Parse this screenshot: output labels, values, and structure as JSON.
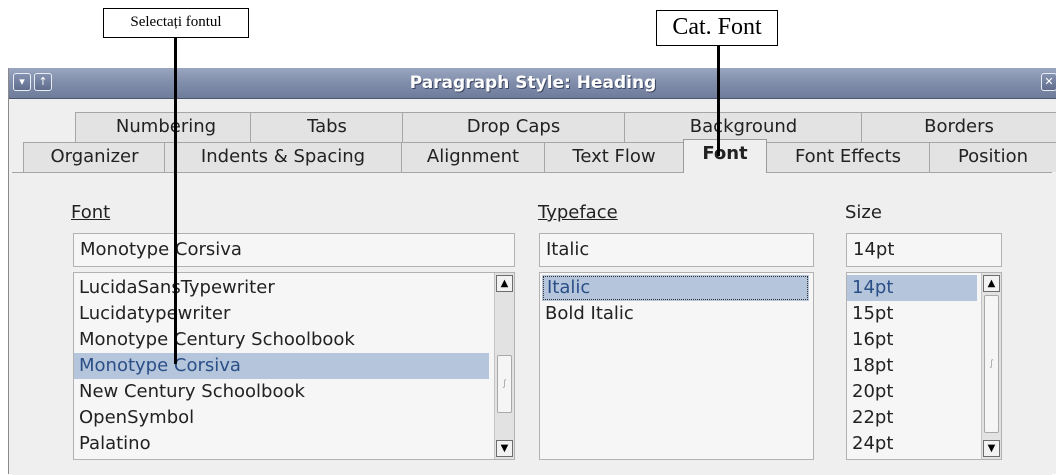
{
  "callouts": {
    "select_font": "Selectați fontul",
    "font_category": "Cat. Font"
  },
  "window": {
    "title": "Paragraph Style: Heading",
    "buttons": {
      "menu": "▾",
      "shade": "↑",
      "close": "✕"
    }
  },
  "tabs": {
    "row1": [
      "Numbering",
      "Tabs",
      "Drop Caps",
      "Background",
      "Borders"
    ],
    "row2": [
      "Organizer",
      "Indents & Spacing",
      "Alignment",
      "Text Flow",
      "Font",
      "Font Effects",
      "Position"
    ],
    "active": "Font"
  },
  "font": {
    "label": "Font",
    "value": "Monotype Corsiva",
    "options": [
      "LucidaSansTypewriter",
      "Lucidatypewriter",
      "Monotype Century Schoolbook",
      "Monotype Corsiva",
      "New Century Schoolbook",
      "OpenSymbol",
      "Palatino"
    ],
    "selected": "Monotype Corsiva"
  },
  "typeface": {
    "label": "Typeface",
    "value": "Italic",
    "options": [
      "Italic",
      "Bold Italic"
    ],
    "selected": "Italic"
  },
  "size": {
    "label": "Size",
    "value": "14pt",
    "options": [
      "14pt",
      "15pt",
      "16pt",
      "18pt",
      "20pt",
      "22pt",
      "24pt"
    ],
    "selected": "14pt"
  },
  "icons": [
    "menu-icon",
    "shade-icon",
    "close-icon",
    "scroll-up-icon",
    "scroll-down-icon",
    "scroll-grip-icon"
  ]
}
